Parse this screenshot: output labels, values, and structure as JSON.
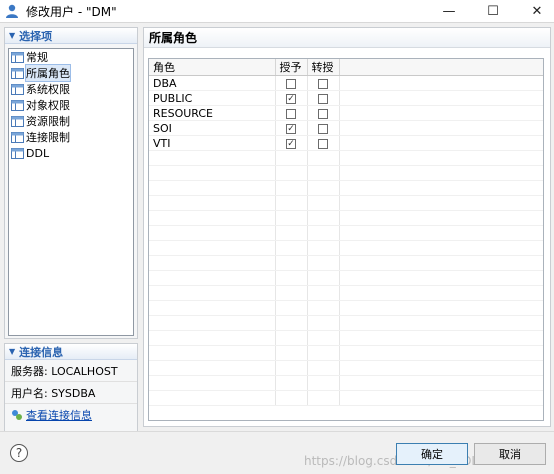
{
  "window": {
    "title": "修改用户 - \"DM\"",
    "controls": {
      "minimize": "—",
      "maximize": "☐",
      "close": "✕"
    }
  },
  "left": {
    "options_header": "选择项",
    "nav_items": [
      {
        "label": "常规",
        "selected": false
      },
      {
        "label": "所属角色",
        "selected": true
      },
      {
        "label": "系统权限",
        "selected": false
      },
      {
        "label": "对象权限",
        "selected": false
      },
      {
        "label": "资源限制",
        "selected": false
      },
      {
        "label": "连接限制",
        "selected": false
      },
      {
        "label": "DDL",
        "selected": false
      }
    ],
    "conn_header": "连接信息",
    "server_line": "服务器: LOCALHOST",
    "user_line": "用户名: SYSDBA",
    "view_link": "查看连接信息"
  },
  "main": {
    "title": "所属角色",
    "columns": [
      "角色",
      "授予",
      "转授"
    ],
    "rows": [
      {
        "role": "DBA",
        "grant": false,
        "regrant": false
      },
      {
        "role": "PUBLIC",
        "grant": true,
        "regrant": false
      },
      {
        "role": "RESOURCE",
        "grant": false,
        "regrant": false
      },
      {
        "role": "SOI",
        "grant": true,
        "regrant": false
      },
      {
        "role": "VTI",
        "grant": true,
        "regrant": false
      }
    ]
  },
  "footer": {
    "help_icon": "?",
    "ok_label": "确定",
    "cancel_label": "取消",
    "watermark": "https://blog.csdn.net/NC_LOL0003"
  }
}
